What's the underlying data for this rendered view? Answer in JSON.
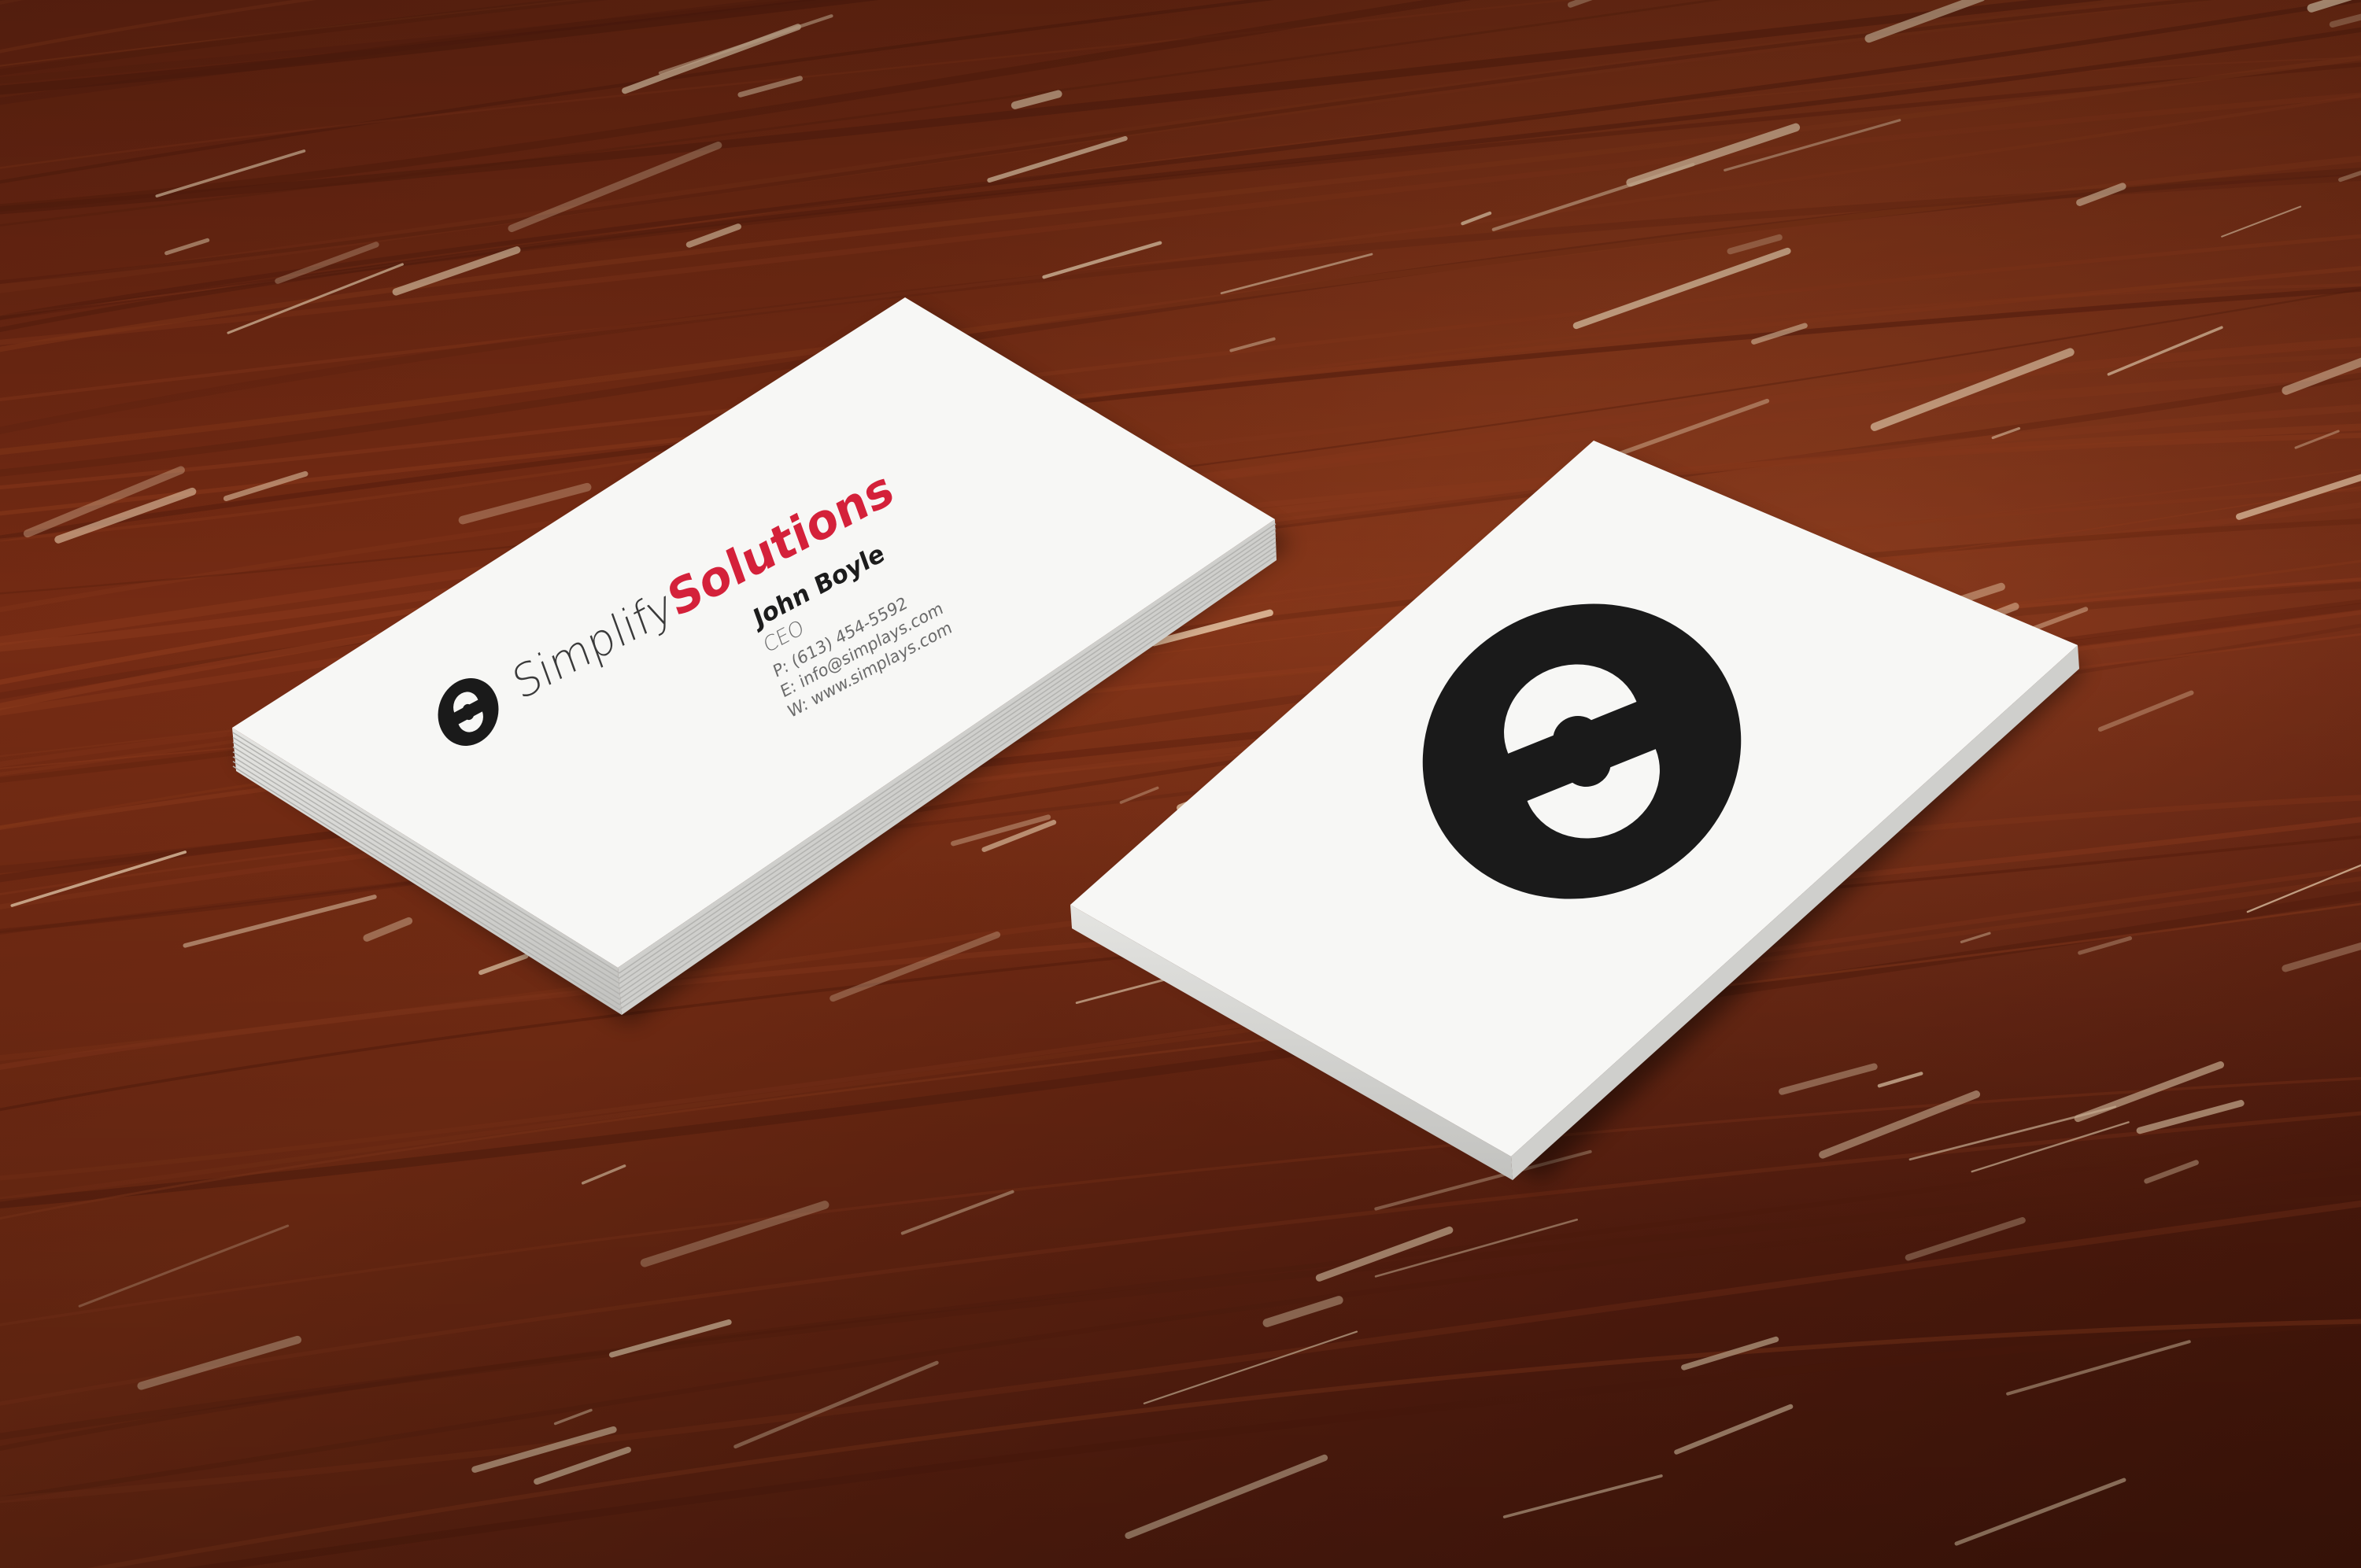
{
  "photo": {
    "subject": "business-cards-on-wooden-table",
    "colors": {
      "wood_dark": "#5a1f0e",
      "wood_mid": "#7a2e16",
      "wood_light": "#8d3a1c",
      "wood_scratch": "#e9c9a8",
      "card_face": "#f7f7f5",
      "card_edge": "#d9d9d6",
      "logo_black": "#1a1a1a",
      "brand_red": "#d4213a",
      "text_dark": "#1c1c1c",
      "text_gray": "#6b6b6b"
    }
  },
  "front_card": {
    "brand_light": "Simplify",
    "brand_bold": "Solutions",
    "name": "John Boyle",
    "title": "CEO",
    "phone": "P: (613) 454-5592",
    "email": "E: info@simplays.com",
    "web": "W: www.simplays.com",
    "logo_icon": "s-logo-icon"
  },
  "back_card": {
    "logo_icon": "s-logo-icon"
  }
}
